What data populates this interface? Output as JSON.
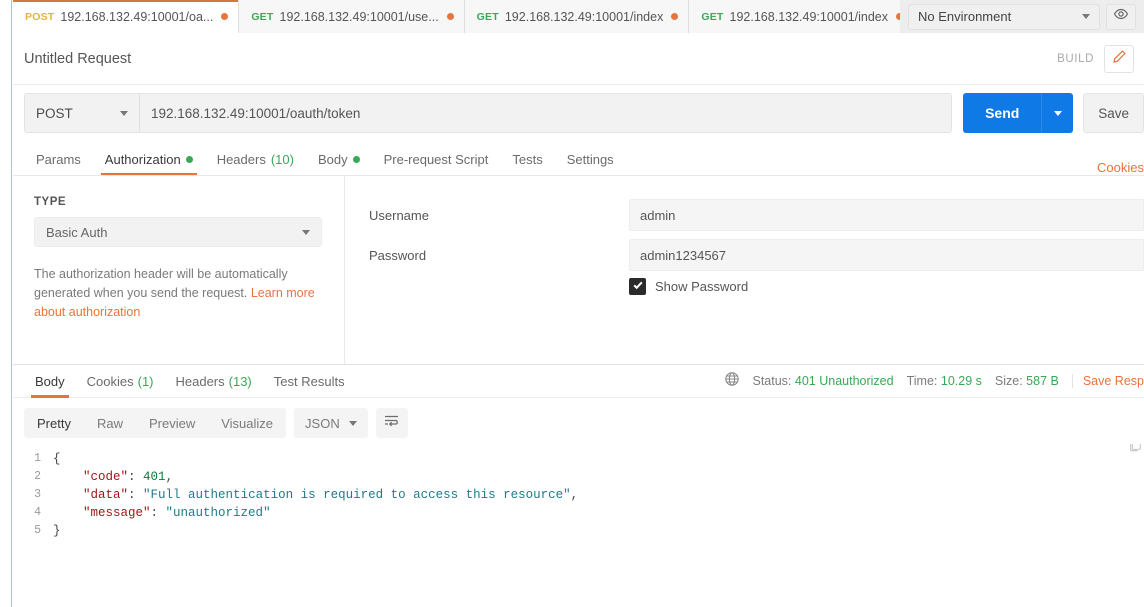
{
  "tabbar": {
    "tabs": [
      {
        "method": "POST",
        "method_class": "post",
        "url": "192.168.132.49:10001/oa...",
        "unsaved": true,
        "active": true
      },
      {
        "method": "GET",
        "method_class": "get",
        "url": "192.168.132.49:10001/use...",
        "unsaved": true,
        "active": false
      },
      {
        "method": "GET",
        "method_class": "get",
        "url": "192.168.132.49:10001/index",
        "unsaved": true,
        "active": false
      },
      {
        "method": "GET",
        "method_class": "get",
        "url": "192.168.132.49:10001/index",
        "unsaved": true,
        "active": false
      }
    ],
    "new_tab_label": "+",
    "more_label": "○○○"
  },
  "environment": {
    "selected": "No Environment",
    "eye_icon": "eye-icon"
  },
  "request_header": {
    "title": "Untitled Request",
    "build_label": "BUILD",
    "edit_icon": "pencil-icon"
  },
  "url_bar": {
    "method": "POST",
    "url": "192.168.132.49:10001/oauth/token",
    "send_label": "Send",
    "save_label": "Save"
  },
  "request_tabs": {
    "items": [
      {
        "label": "Params",
        "dot": false,
        "count": "",
        "active": false
      },
      {
        "label": "Authorization",
        "dot": true,
        "count": "",
        "active": true
      },
      {
        "label": "Headers",
        "dot": false,
        "count": "(10)",
        "active": false
      },
      {
        "label": "Body",
        "dot": true,
        "count": "",
        "active": false
      },
      {
        "label": "Pre-request Script",
        "dot": false,
        "count": "",
        "active": false
      },
      {
        "label": "Tests",
        "dot": false,
        "count": "",
        "active": false
      },
      {
        "label": "Settings",
        "dot": false,
        "count": "",
        "active": false
      }
    ],
    "cookies_link": "Cookies"
  },
  "authorization": {
    "type_label": "TYPE",
    "type_value": "Basic Auth",
    "note_text": "The authorization header will be automatically generated when you send the request. ",
    "note_link": "Learn more about authorization",
    "username_label": "Username",
    "username_value": "admin",
    "password_label": "Password",
    "password_value": "admin1234567",
    "show_password_label": "Show Password",
    "show_password_checked": true
  },
  "response_tabs": {
    "items": [
      {
        "label": "Body",
        "count": "",
        "active": true
      },
      {
        "label": "Cookies",
        "count": "(1)",
        "active": false
      },
      {
        "label": "Headers",
        "count": "(13)",
        "active": false
      },
      {
        "label": "Test Results",
        "count": "",
        "active": false
      }
    ],
    "status_label": "Status:",
    "status_value": "401 Unauthorized",
    "time_label": "Time:",
    "time_value": "10.29 s",
    "size_label": "Size:",
    "size_value": "587 B",
    "save_response_label": "Save Resp",
    "globe_icon": "globe-icon"
  },
  "response_toolbar": {
    "formats": [
      {
        "label": "Pretty",
        "active": true
      },
      {
        "label": "Raw",
        "active": false
      },
      {
        "label": "Preview",
        "active": false
      },
      {
        "label": "Visualize",
        "active": false
      }
    ],
    "language": "JSON",
    "wrap_icon": "wrap-lines-icon",
    "copy_icon": "copy-icon"
  },
  "response_body": {
    "lines": [
      {
        "num": "1",
        "segments": [
          {
            "t": "{",
            "c": "p"
          }
        ]
      },
      {
        "num": "2",
        "segments": [
          {
            "t": "    ",
            "c": "p"
          },
          {
            "t": "\"code\"",
            "c": "k"
          },
          {
            "t": ": ",
            "c": "p"
          },
          {
            "t": "401",
            "c": "n"
          },
          {
            "t": ",",
            "c": "p"
          }
        ]
      },
      {
        "num": "3",
        "segments": [
          {
            "t": "    ",
            "c": "p"
          },
          {
            "t": "\"data\"",
            "c": "k"
          },
          {
            "t": ": ",
            "c": "p"
          },
          {
            "t": "\"Full authentication is required to access this resource\"",
            "c": "s"
          },
          {
            "t": ",",
            "c": "p"
          }
        ]
      },
      {
        "num": "4",
        "segments": [
          {
            "t": "    ",
            "c": "p"
          },
          {
            "t": "\"message\"",
            "c": "k"
          },
          {
            "t": ": ",
            "c": "p"
          },
          {
            "t": "\"unauthorized\"",
            "c": "s"
          }
        ]
      },
      {
        "num": "5",
        "segments": [
          {
            "t": "}",
            "c": "p"
          }
        ]
      }
    ]
  },
  "colors": {
    "accent_orange": "#e8743b",
    "send_blue": "#0f7ae5",
    "success_green": "#3aa856",
    "post_yellow": "#e8b33a"
  }
}
